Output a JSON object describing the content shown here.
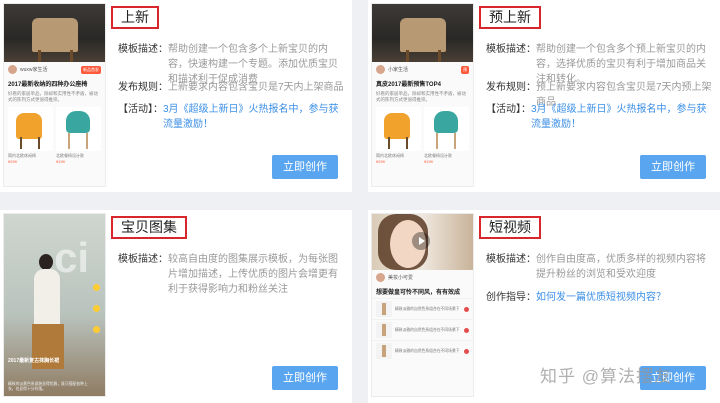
{
  "cards": [
    {
      "title": "上新",
      "rows": [
        {
          "key": "模板描述：",
          "value": "帮助创建一个包含多个上新宝贝的内容，快速构建一个专题。添加优质宝贝和描述利于促成消费"
        },
        {
          "key": "发布规则：",
          "value": "上新要求内容包含宝贝是7天内上架商品"
        },
        {
          "key": "【活动】：",
          "value": "3月《超级上新日》火热报名中，参与获流量激励！"
        }
      ],
      "button": "立即创作",
      "thumb": {
        "user": "wuxw家生活",
        "tag": "新品首发",
        "post_title": "2017最新收纳的四种办公座椅",
        "desc": "好看的家居单品，除却和实用性不矛盾，被动式的陈列方式更值得推崇。"
      }
    },
    {
      "title": "预上新",
      "rows": [
        {
          "key": "模板描述：",
          "value": "帮助创建一个包含多个预上新宝贝的内容，选择优质的宝贝有利于增加商品关注和转化。"
        },
        {
          "key": "发布规则：",
          "value": "预上新要求内容包含宝贝是7天内预上架商品"
        },
        {
          "key": "【活动】：",
          "value": "3月《超级上新日》火热报名中，参与获流量激励！"
        }
      ],
      "button": "立即创作",
      "thumb": {
        "user": "小家生活",
        "tag": "预",
        "post_title": "真皮2017最新预售TOP4",
        "desc": "好看的家居单品，除却和实用性不矛盾，被动式的陈列方式更值得推崇。"
      }
    },
    {
      "title": "宝贝图集",
      "rows": [
        {
          "key": "模板描述：",
          "value": "较高自由度的图集展示模板，为每张图片增加描述，上传优质的图片会增更有利于获得影响力和粉丝关注"
        }
      ],
      "button": "立即创作",
      "thumb": {
        "caption": "2017最新复古抹胸长裙",
        "desc": "精致的淡黄色系裙装显得优雅，既可搭配各种上衣，也显得十分利落。"
      }
    },
    {
      "title": "短视频",
      "rows": [
        {
          "key": "模板描述：",
          "value": "创作自由度高，优质多样的视频内容将提升粉丝的浏览和受欢迎度"
        },
        {
          "key": "创作指导：",
          "value": "如何发一篇优质短视频内容？",
          "link": true
        }
      ],
      "button": "立即创作",
      "thumb": {
        "user": "美妆小可爱",
        "post_title": "想要做皇可怜不同风，有有效成",
        "items": [
          "精致淡雅的自然色系组合在不同场景下",
          "精致淡雅的自然色系组合在不同场景下",
          "精致淡雅的自然色系组合在不同场景下"
        ]
      }
    }
  ],
  "watermark": "知乎 @算法摆友"
}
